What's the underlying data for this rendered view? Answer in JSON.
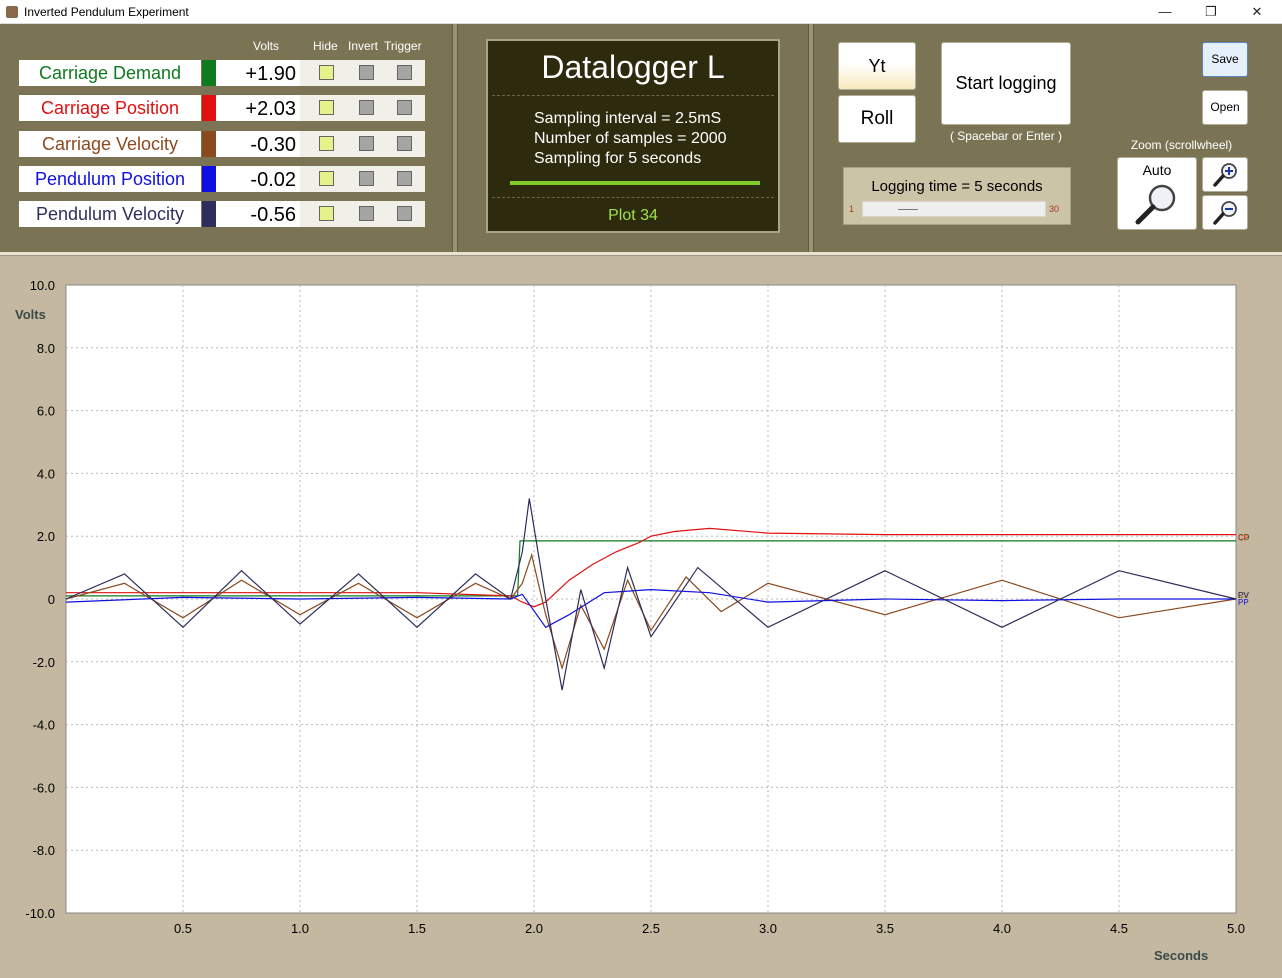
{
  "window": {
    "title": "Inverted Pendulum Experiment",
    "minimize": "—",
    "maximize": "❐",
    "close": "✕"
  },
  "columns": {
    "volts": "Volts",
    "hide": "Hide",
    "invert": "Invert",
    "trigger": "Trigger"
  },
  "channels": [
    {
      "name": "Carriage Demand",
      "value": "+1.90",
      "color": "#0f7a1f",
      "abbr": "CD"
    },
    {
      "name": "Carriage Position",
      "value": "+2.03",
      "color": "#e01010",
      "abbr": "CP"
    },
    {
      "name": "Carriage Velocity",
      "value": "-0.30",
      "color": "#8b4a1e",
      "abbr": "CV"
    },
    {
      "name": "Pendulum Position",
      "value": "-0.02",
      "color": "#1010e0",
      "abbr": "PP"
    },
    {
      "name": "Pendulum Velocity",
      "value": "-0.56",
      "color": "#2e2e5c",
      "abbr": "PV"
    }
  ],
  "datalogger": {
    "title": "Datalogger L",
    "line1": "Sampling interval = 2.5mS",
    "line2": "Number of samples = 2000",
    "line3": "Sampling for 5 seconds",
    "plot": "Plot 34"
  },
  "controls": {
    "yt": "Yt",
    "roll": "Roll",
    "start": "Start logging",
    "start_hint": "( Spacebar or Enter )",
    "logging_time": "Logging time = 5 seconds",
    "log_min": "1",
    "log_max": "30",
    "log_value_seconds": 5,
    "save": "Save",
    "open": "Open",
    "zoom_label": "Zoom  (scrollwheel)",
    "auto": "Auto"
  },
  "chart_data": {
    "type": "line",
    "xlabel": "Seconds",
    "ylabel": "Volts",
    "xlim": [
      0,
      5
    ],
    "ylim": [
      -10,
      10
    ],
    "xticks": [
      "0.5",
      "1.0",
      "1.5",
      "2.0",
      "2.5",
      "3.0",
      "3.5",
      "4.0",
      "4.5",
      "5.0"
    ],
    "yticks": [
      "10.0",
      "8.0",
      "6.0",
      "4.0",
      "2.0",
      "0",
      "-2.0",
      "-4.0",
      "-6.0",
      "-8.0",
      "-10.0"
    ],
    "grid": true,
    "series": [
      {
        "name": "CD",
        "color": "#0f7a1f",
        "x": [
          0,
          1.93,
          1.93,
          1.94,
          5.0
        ],
        "values": [
          0.1,
          0.1,
          0.1,
          1.85,
          1.85
        ]
      },
      {
        "name": "CP",
        "color": "#e01010",
        "x": [
          0,
          0.5,
          1.0,
          1.5,
          1.9,
          1.95,
          2.0,
          2.05,
          2.15,
          2.25,
          2.35,
          2.45,
          2.5,
          2.6,
          2.75,
          3.0,
          3.5,
          4.0,
          4.5,
          5.0
        ],
        "values": [
          0.2,
          0.2,
          0.2,
          0.2,
          0.1,
          -0.1,
          -0.25,
          -0.1,
          0.6,
          1.1,
          1.5,
          1.8,
          2.0,
          2.15,
          2.25,
          2.1,
          2.05,
          2.05,
          2.05,
          2.05
        ]
      },
      {
        "name": "CV",
        "color": "#8b4a1e",
        "x": [
          0,
          0.25,
          0.5,
          0.75,
          1.0,
          1.25,
          1.5,
          1.75,
          1.9,
          1.95,
          1.99,
          2.05,
          2.12,
          2.2,
          2.3,
          2.4,
          2.5,
          2.65,
          2.8,
          3.0,
          3.5,
          4.0,
          4.5,
          5.0
        ],
        "values": [
          0,
          0.5,
          -0.6,
          0.6,
          -0.5,
          0.5,
          -0.6,
          0.5,
          0,
          0.5,
          1.4,
          -0.5,
          -2.2,
          -0.2,
          -1.6,
          0.6,
          -1.0,
          0.7,
          -0.4,
          0.5,
          -0.5,
          0.6,
          -0.6,
          0
        ]
      },
      {
        "name": "PP",
        "color": "#1010e0",
        "x": [
          0,
          0.5,
          1.0,
          1.5,
          1.9,
          1.95,
          2.05,
          2.15,
          2.3,
          2.5,
          2.75,
          3.0,
          3.5,
          4.0,
          4.5,
          5.0
        ],
        "values": [
          -0.1,
          0.05,
          0,
          0.05,
          0,
          0.15,
          -0.9,
          -0.5,
          0.2,
          0.3,
          0.2,
          -0.1,
          0,
          -0.05,
          0,
          0
        ]
      },
      {
        "name": "PV",
        "color": "#2e2e5c",
        "x": [
          0,
          0.25,
          0.5,
          0.75,
          1.0,
          1.25,
          1.5,
          1.75,
          1.9,
          1.95,
          1.98,
          2.05,
          2.12,
          2.2,
          2.3,
          2.4,
          2.5,
          2.7,
          3.0,
          3.5,
          4.0,
          4.5,
          5.0
        ],
        "values": [
          0,
          0.8,
          -0.9,
          0.9,
          -0.8,
          0.8,
          -0.9,
          0.8,
          0,
          1.5,
          3.2,
          0,
          -2.9,
          0.3,
          -2.2,
          1.0,
          -1.2,
          1.0,
          -0.9,
          0.9,
          -0.9,
          0.9,
          0
        ]
      }
    ]
  }
}
